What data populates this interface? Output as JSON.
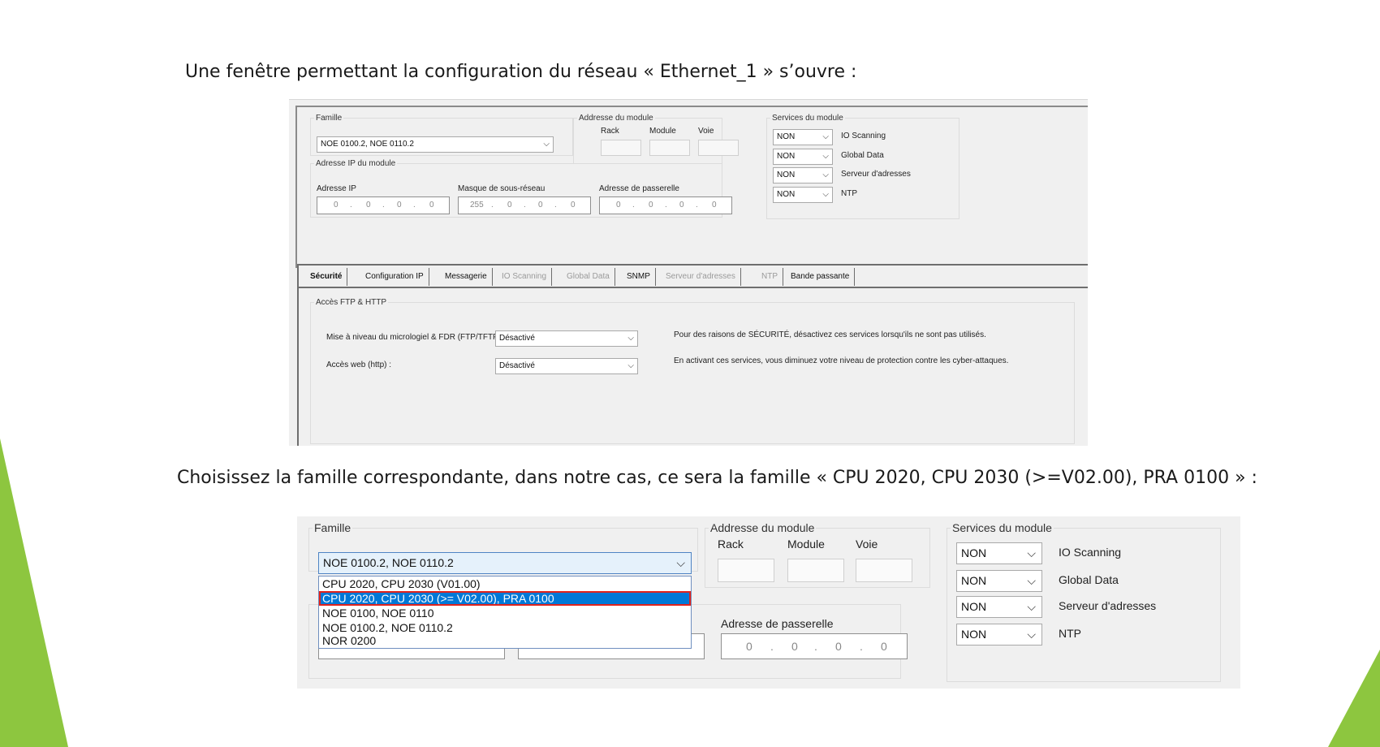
{
  "captions": {
    "intro": "Une fenêtre permettant la configuration du réseau « Ethernet_1 » s’ouvre :",
    "choose": "Choisissez la famille correspondante, dans notre cas, ce sera la famille « CPU 2020, CPU 2030 (>=V02.00), PRA 0100 » :"
  },
  "config": {
    "famille_label": "Famille",
    "famille_value": "NOE 0100.2, NOE 0110.2",
    "module_address": {
      "legend": "Addresse du module",
      "rack_label": "Rack",
      "module_label": "Module",
      "voie_label": "Voie"
    },
    "ip_group_label": "Adresse IP du module",
    "ip_address": {
      "label": "Adresse IP",
      "octets": [
        "0",
        "0",
        "0",
        "0"
      ]
    },
    "subnet_mask": {
      "label": "Masque de sous-réseau",
      "octets": [
        "255",
        "0",
        "0",
        "0"
      ]
    },
    "gateway": {
      "label": "Adresse de passerelle",
      "octets": [
        "0",
        "0",
        "0",
        "0"
      ]
    },
    "services": {
      "legend": "Services du module",
      "items": [
        {
          "value": "NON",
          "label": "IO Scanning"
        },
        {
          "value": "NON",
          "label": "Global Data"
        },
        {
          "value": "NON",
          "label": "Serveur d'adresses"
        },
        {
          "value": "NON",
          "label": "NTP"
        }
      ]
    },
    "tabs": [
      {
        "label": "Sécurité",
        "state": "active"
      },
      {
        "label": "Configuration IP",
        "state": "normal"
      },
      {
        "label": "Messagerie",
        "state": "normal"
      },
      {
        "label": "IO Scanning",
        "state": "disabled"
      },
      {
        "label": "Global Data",
        "state": "disabled"
      },
      {
        "label": "SNMP",
        "state": "normal"
      },
      {
        "label": "Serveur d'adresses",
        "state": "disabled"
      },
      {
        "label": "NTP",
        "state": "disabled"
      },
      {
        "label": "Bande passante",
        "state": "normal"
      }
    ],
    "security": {
      "legend": "Accès FTP & HTTP",
      "firmware_label": "Mise à niveau du micrologiel & FDR (FTP/TFTP):",
      "firmware_value": "Désactivé",
      "web_label": "Accès web (http) :",
      "web_value": "Désactivé",
      "note1": "Pour des raisons de SÉCURITÉ, désactivez ces services lorsqu'ils ne sont pas utilisés.",
      "note2": "En activant ces services, vous diminuez votre niveau de protection contre les cyber-attaques."
    }
  },
  "dropdown": {
    "options": [
      "CPU 2020, CPU 2030 (V01.00)",
      "CPU 2020, CPU 2030 (>= V02.00), PRA 0100",
      "NOE 0100, NOE 0110",
      "NOE 0100.2, NOE 0110.2",
      "NOR 0200"
    ],
    "highlighted_index": 1
  },
  "colors": {
    "slide_green": "#8dc63f",
    "selection_blue": "#0078d7",
    "highlight_red": "#e0231c"
  }
}
